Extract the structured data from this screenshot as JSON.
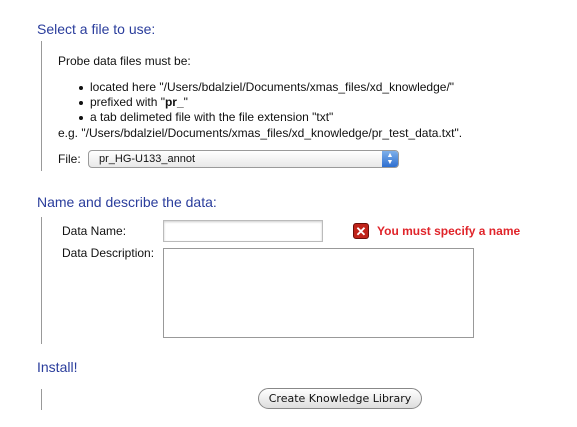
{
  "section1": {
    "title": "Select a file to use:",
    "intro": "Probe data files must be:",
    "bullets": [
      "located here \"/Users/bdalziel/Documents/xmas_files/xd_knowledge/\"",
      "a tab delimeted file with the file extension \"txt\""
    ],
    "prefix_before": "prefixed with \"",
    "prefix_bold": "pr_",
    "prefix_after": "\"",
    "example": "e.g. \"/Users/bdalziel/Documents/xmas_files/xd_knowledge/pr_test_data.txt\".",
    "file_label": "File:",
    "file_selected": "pr_HG-U133_annot"
  },
  "section2": {
    "title": "Name and describe the data:",
    "name_label": "Data Name:",
    "name_value": "",
    "description_label": "Data Description:",
    "description_value": "",
    "error_text": "You must specify a name",
    "error_color": "#e0242a"
  },
  "section3": {
    "title": "Install!",
    "button_label": "Create Knowledge Library"
  }
}
